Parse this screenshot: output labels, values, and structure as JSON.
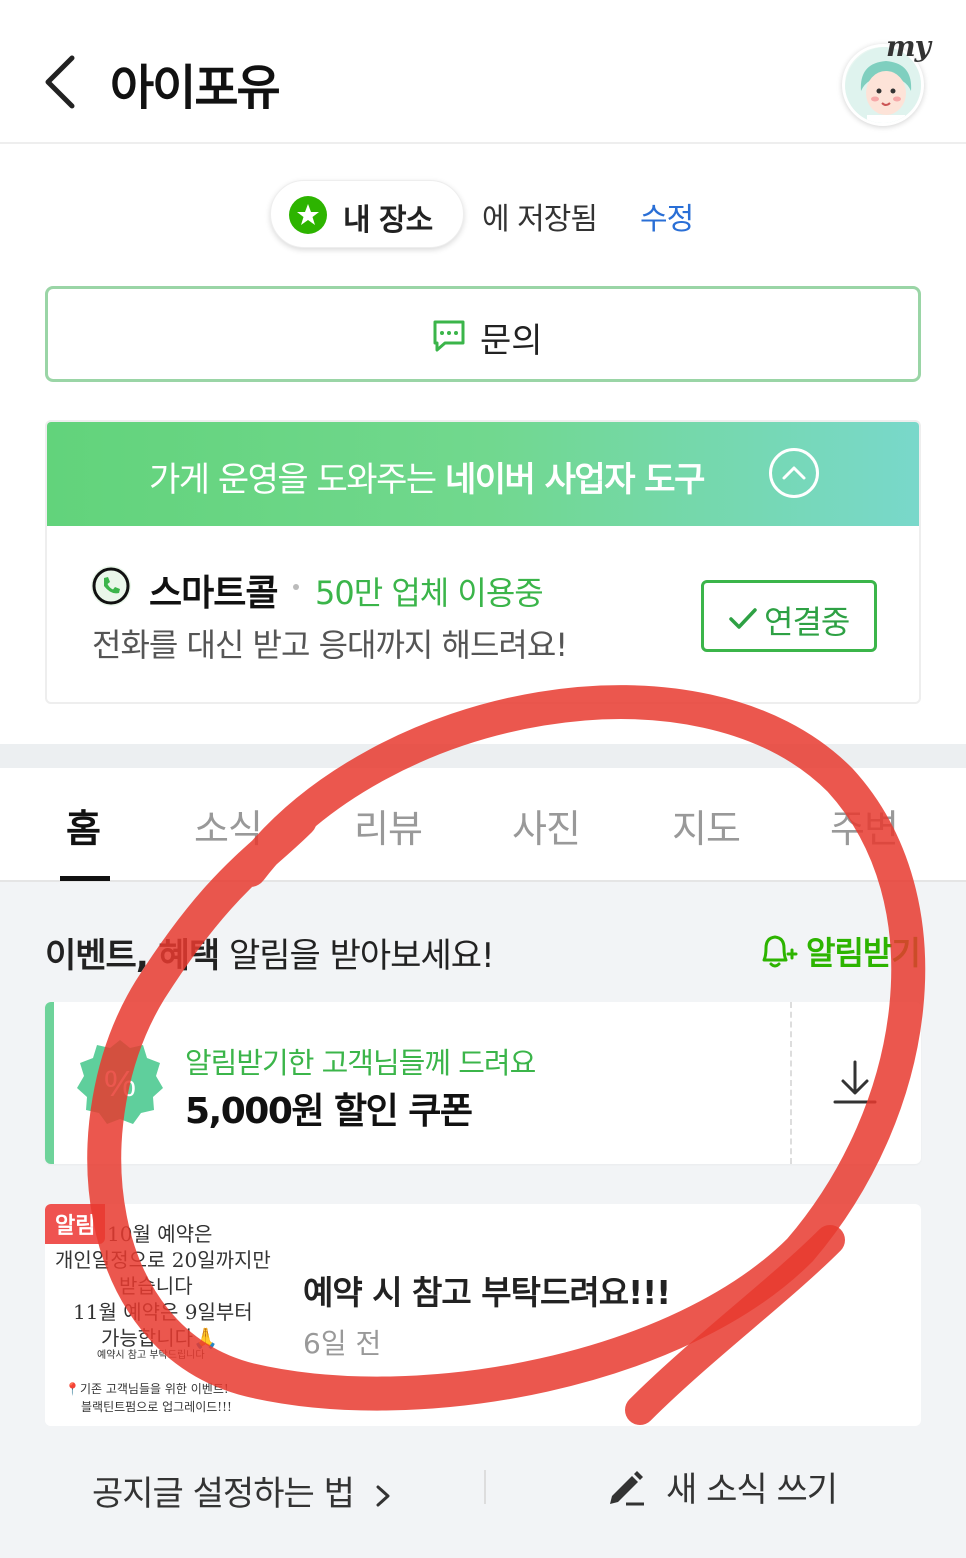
{
  "header": {
    "title": "아이포유",
    "profile_badge": "my"
  },
  "saved": {
    "pill_label": "내 장소",
    "saved_text": "에 저장됨",
    "edit_label": "수정"
  },
  "inquiry": {
    "label": "문의"
  },
  "business_tools": {
    "banner_prefix": "가게 운영을 도와주는 ",
    "banner_bold": "네이버 사업자 도구",
    "smartcall": {
      "name": "스마트콜",
      "users": "50만 업체 이용중",
      "description": "전화를 대신 받고 응대까지 해드려요!",
      "connect_label": "연결중"
    }
  },
  "tabs": [
    {
      "label": "홈",
      "active": true
    },
    {
      "label": "소식",
      "active": false
    },
    {
      "label": "리뷰",
      "active": false
    },
    {
      "label": "사진",
      "active": false
    },
    {
      "label": "지도",
      "active": false
    },
    {
      "label": "주변",
      "active": false
    }
  ],
  "notification": {
    "title_bold": "이벤트, 혜택",
    "title_rest": " 알림을 받아보세요!",
    "button_label": "알림받기"
  },
  "coupon": {
    "subtitle": "알림받기한 고객님들께 드려요",
    "title": "5,000원 할인 쿠폰",
    "badge_symbol": "%"
  },
  "notice": {
    "badge": "알림",
    "thumbnail_lines": [
      "10월 예약은",
      "개인일정으로 20일까지만",
      "받습니다",
      "11월 예약은 9일부터",
      "가능합니다🙏",
      "예약시 참고 부탁드립니다",
      "📍기존 고객님들을 위한 이벤트!",
      "블랙틴트펌으로 업그레이드!!!"
    ],
    "title": "예약 시 참고 부탁드려요!!!",
    "time": "6일 전"
  },
  "footer": {
    "howto_label": "공지글 설정하는 법",
    "write_label": "새 소식 쓰기"
  },
  "colors": {
    "naver_green": "#2db400",
    "accent_blue": "#2a6fd6",
    "annotation_red": "#e8392f"
  }
}
